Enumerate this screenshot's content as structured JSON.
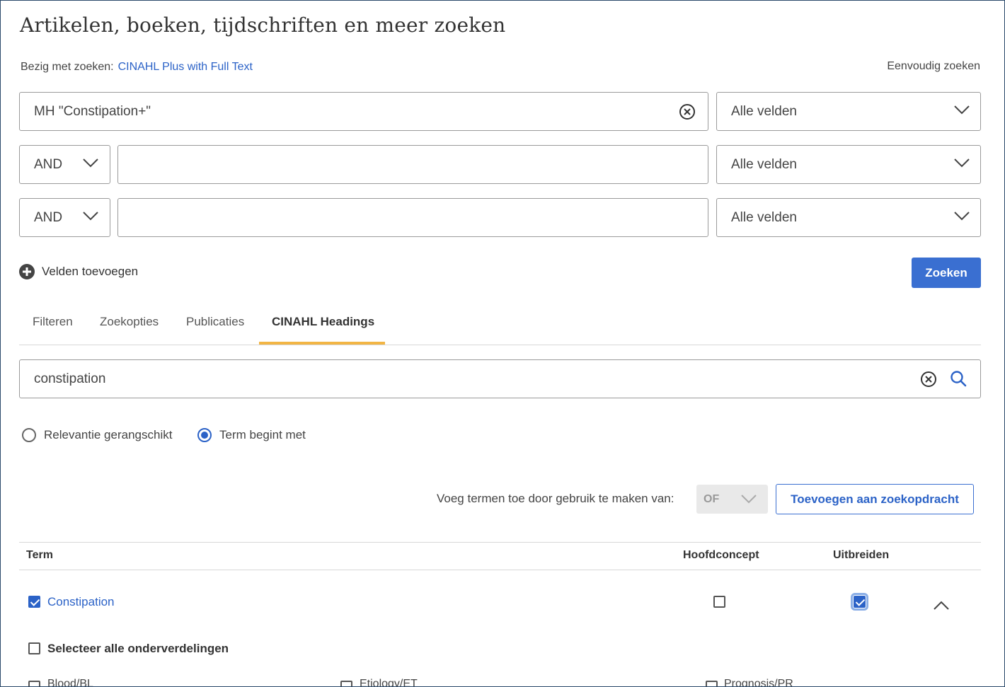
{
  "header": {
    "title": "Artikelen, boeken, tijdschriften en meer zoeken",
    "searching_label": "Bezig met zoeken:",
    "database": "CINAHL Plus with Full Text",
    "simple_search_link": "Eenvoudig zoeken"
  },
  "search_rows": [
    {
      "operator": null,
      "value": "MH \"Constipation+\"",
      "field": "Alle velden"
    },
    {
      "operator": "AND",
      "value": "",
      "field": "Alle velden"
    },
    {
      "operator": "AND",
      "value": "",
      "field": "Alle velden"
    }
  ],
  "add_fields_label": "Velden toevoegen",
  "search_button_label": "Zoeken",
  "tabs": [
    {
      "label": "Filteren",
      "active": false
    },
    {
      "label": "Zoekopties",
      "active": false
    },
    {
      "label": "Publicaties",
      "active": false
    },
    {
      "label": "CINAHL Headings",
      "active": true
    }
  ],
  "headings_search": {
    "value": "constipation"
  },
  "radio_options": [
    {
      "label": "Relevantie gerangschikt",
      "checked": false
    },
    {
      "label": "Term begint met",
      "checked": true
    }
  ],
  "combine": {
    "label": "Voeg termen toe door gebruik te maken van:",
    "operator": "OF",
    "add_button": "Toevoegen aan zoekopdracht"
  },
  "table": {
    "headers": {
      "term": "Term",
      "major": "Hoofdconcept",
      "explode": "Uitbreiden"
    },
    "rows": [
      {
        "term": "Constipation",
        "selected": true,
        "major": false,
        "explode": true
      }
    ],
    "select_all_label": "Selecteer alle onderverdelingen",
    "subdivisions": [
      "Blood/BL",
      "Etiology/ET",
      "Prognosis/PR"
    ]
  },
  "colors": {
    "accent": "#2b62c7",
    "button": "#3a6fd1",
    "tab_underline": "#f2b544",
    "border": "#2b4a6b"
  }
}
